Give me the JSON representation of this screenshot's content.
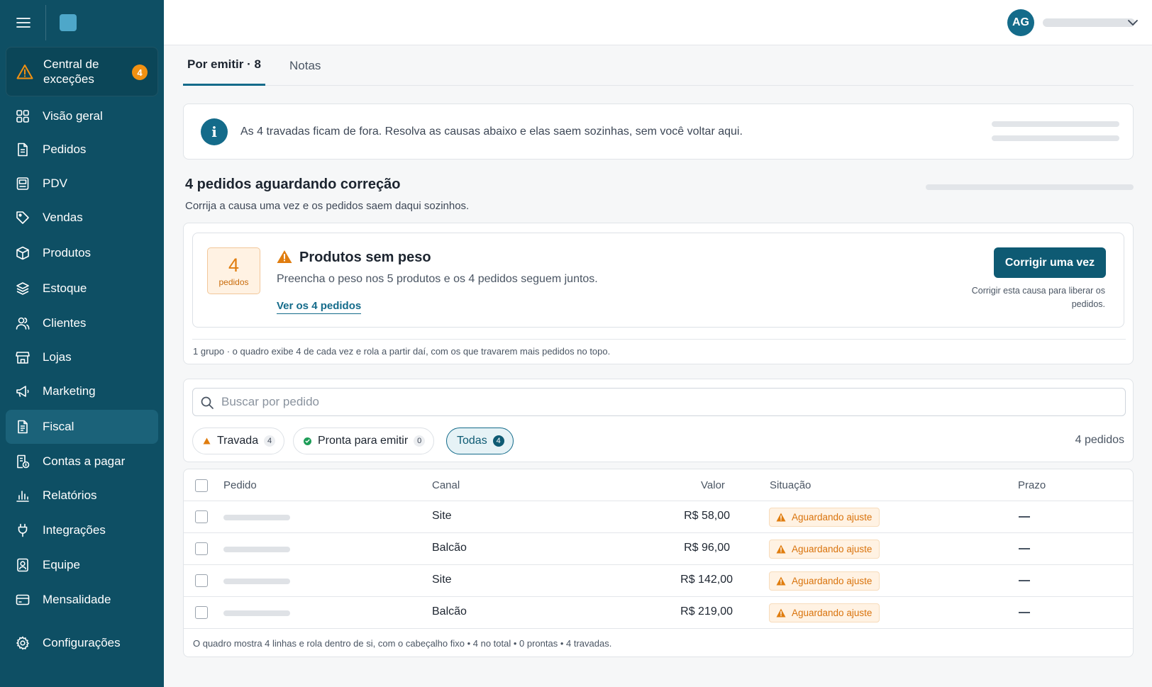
{
  "sidebar": {
    "exceptions": {
      "label": "Central de exceções",
      "badge": "4"
    },
    "items": [
      {
        "label": "Visão geral",
        "icon": "grid-icon"
      },
      {
        "label": "Pedidos",
        "icon": "document-icon"
      },
      {
        "label": "PDV",
        "icon": "pos-terminal-icon"
      },
      {
        "label": "Vendas",
        "icon": "tag-icon"
      },
      {
        "label": "Produtos",
        "icon": "box-icon"
      },
      {
        "label": "Estoque",
        "icon": "layers-icon"
      },
      {
        "label": "Clientes",
        "icon": "users-icon"
      },
      {
        "label": "Lojas",
        "icon": "store-icon"
      },
      {
        "label": "Marketing",
        "icon": "megaphone-icon"
      },
      {
        "label": "Fiscal",
        "icon": "receipt-icon",
        "active": true
      },
      {
        "label": "Contas a pagar",
        "icon": "bill-icon"
      },
      {
        "label": "Relatórios",
        "icon": "bar-chart-icon"
      },
      {
        "label": "Integrações",
        "icon": "plug-icon"
      },
      {
        "label": "Equipe",
        "icon": "id-badge-icon"
      },
      {
        "label": "Mensalidade",
        "icon": "credit-card-icon"
      }
    ],
    "settings": {
      "label": "Configurações",
      "icon": "gear-icon"
    }
  },
  "header": {
    "avatar_initials": "AG"
  },
  "tabs": [
    {
      "label": "Por emitir · 8",
      "active": true
    },
    {
      "label": "Notas",
      "active": false
    }
  ],
  "info_banner": {
    "text": "As 4 travadas ficam de fora. Resolva as causas abaixo e elas saem sozinhas, sem você voltar aqui."
  },
  "section": {
    "title": "4 pedidos aguardando correção",
    "subtitle": "Corrija a causa uma vez e os pedidos saem daqui sozinhos."
  },
  "cause": {
    "count": "4",
    "count_label": "pedidos",
    "title": "Produtos sem peso",
    "description": "Preencha o peso nos 5 produtos e os 4 pedidos seguem juntos.",
    "link": "Ver os 4 pedidos",
    "button": "Corrigir uma vez",
    "note": "Corrigir esta causa para liberar os pedidos.",
    "group_note": "1 grupo · o quadro exibe 4 de cada vez e rola a partir daí, com os que travarem mais pedidos no topo."
  },
  "filters": {
    "search_placeholder": "Buscar por pedido",
    "chips": [
      {
        "label": "Travada",
        "count": "4"
      },
      {
        "label": "Pronta para emitir",
        "count": "0"
      },
      {
        "label": "Todas",
        "count": "4",
        "active": true
      }
    ],
    "total": "4 pedidos"
  },
  "table": {
    "columns": [
      "Pedido",
      "Canal",
      "Valor",
      "Situação",
      "Prazo"
    ],
    "rows": [
      {
        "canal": "Site",
        "valor": "R$ 58,00",
        "situacao": "Aguardando ajuste",
        "prazo": "—"
      },
      {
        "canal": "Balcão",
        "valor": "R$ 96,00",
        "situacao": "Aguardando ajuste",
        "prazo": "—"
      },
      {
        "canal": "Site",
        "valor": "R$ 142,00",
        "situacao": "Aguardando ajuste",
        "prazo": "—"
      },
      {
        "canal": "Balcão",
        "valor": "R$ 219,00",
        "situacao": "Aguardando ajuste",
        "prazo": "—"
      }
    ],
    "footer": "O quadro mostra 4 linhas e rola dentro de si, com o cabeçalho fixo • 4 no total • 0 prontas • 4 travadas."
  },
  "colors": {
    "sidebar_bg": "#0e4f64",
    "accent": "#146b8a",
    "warning": "#e07d0f",
    "success": "#1e9d58"
  }
}
